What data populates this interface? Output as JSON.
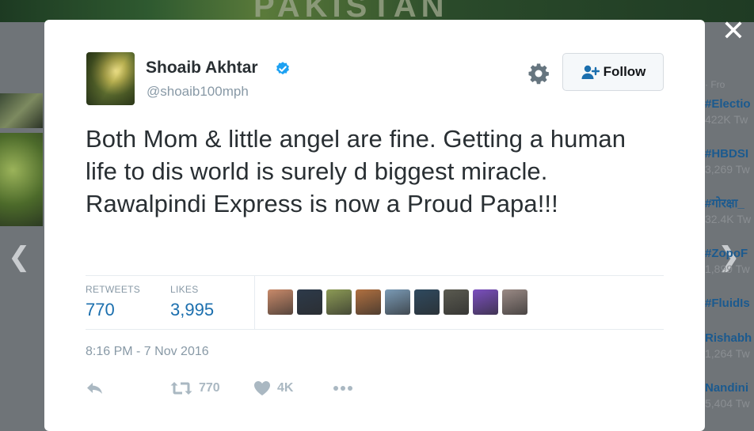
{
  "background": {
    "banner_text": "PAKISTAN",
    "trends": {
      "header": "· Fro",
      "items": [
        {
          "name": "#Electio",
          "count": "422K Tw"
        },
        {
          "name": "#HBDSI",
          "count": "3,269 Tw"
        },
        {
          "name": "#गोरक्षा_",
          "count": "32.4K Tw"
        },
        {
          "name": "#ZopoF",
          "count": "1,899 Tw"
        },
        {
          "name": "#FluidIs",
          "count": ""
        },
        {
          "name": "Rishabh",
          "count": "1,264 Tw"
        },
        {
          "name": "Nandini",
          "count": "5,404 Tw"
        }
      ]
    },
    "nav": {
      "prev_icon": "chevron-left-icon",
      "next_icon": "chevron-right-icon"
    },
    "close_icon": "close-icon"
  },
  "tweet": {
    "user": {
      "name": "Shoaib Akhtar",
      "handle": "@shoaib100mph",
      "verified_icon": "verified-badge-icon"
    },
    "follow_label": "Follow",
    "text": "Both Mom & little angel are fine. Getting a human life to dis world is surely d biggest miracle. Rawalpindi Express is now a Proud Papa!!!",
    "stats": {
      "retweets_label": "RETWEETS",
      "retweets": "770",
      "likes_label": "LIKES",
      "likes": "3,995"
    },
    "liker_colors": [
      "#c98a6a",
      "#2d3a4a",
      "#8c9a55",
      "#b07040",
      "#7a9ab5",
      "#2f4a5f",
      "#5a5a50",
      "#7b4fbf",
      "#9a8a85"
    ],
    "timestamp": "8:16 PM - 7 Nov 2016",
    "actions": {
      "reply_icon": "reply-icon",
      "retweet_icon": "retweet-icon",
      "retweet_count": "770",
      "like_icon": "heart-icon",
      "like_count": "4K",
      "more_icon": "more-dots-icon"
    }
  },
  "colors": {
    "accent": "#1b6fae",
    "verified": "#1da1f2",
    "muted": "#8899a6",
    "action_icon": "#aab8c2"
  }
}
